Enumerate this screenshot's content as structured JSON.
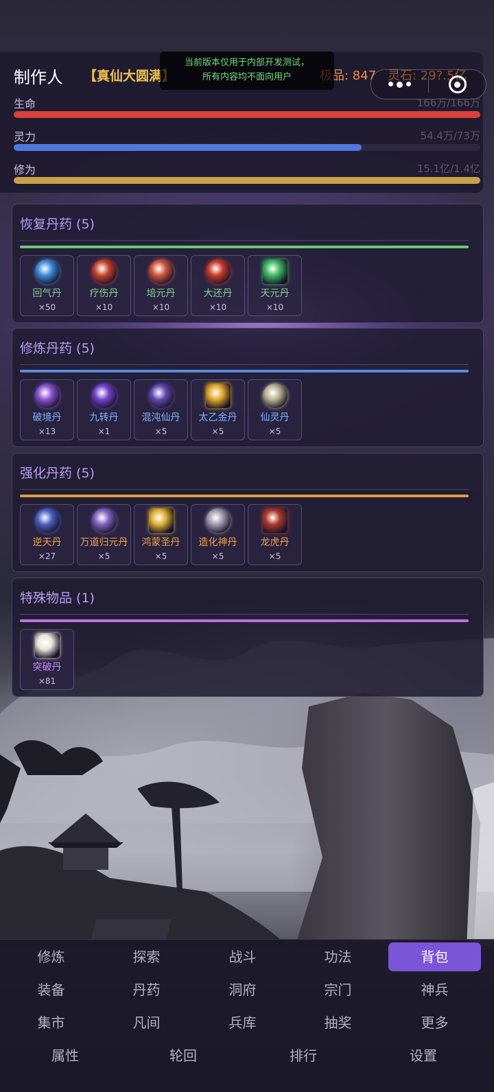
{
  "player": {
    "name": "制作人",
    "realm": "【真仙大圆满】",
    "jipin": "极品: 847",
    "lingshi": "灵石: 29?.5亿"
  },
  "dev_notice": {
    "line1": "当前版本仅用于内部开发测试，",
    "line2": "所有内容均不面向用户"
  },
  "capsule": {
    "more_icon": "more-dots-icon",
    "close_icon": "target-close-icon"
  },
  "bars": [
    {
      "label": "生命",
      "value": "166万/166万",
      "fraction": 1.0,
      "color": "#d8403c"
    },
    {
      "label": "灵力",
      "value": "54.4万/73万",
      "fraction": 0.745,
      "color": "#4f78dd"
    },
    {
      "label": "修为",
      "value": "15.1亿/1.4亿",
      "fraction": 1.0,
      "color": "#c9a04a"
    }
  ],
  "sections": [
    {
      "title": "恢复丹药 (5)",
      "rule_color": "#6cc86e",
      "name_class": "green",
      "items": [
        {
          "name": "回气丹",
          "count": "×50",
          "icon": "swirl-pill-icon",
          "color": "#3a8ad8"
        },
        {
          "name": "疗伤丹",
          "count": "×10",
          "icon": "red-pill-icon",
          "color": "#c8402c"
        },
        {
          "name": "培元丹",
          "count": "×10",
          "icon": "red-pill-icon",
          "color": "#d0523c"
        },
        {
          "name": "大还丹",
          "count": "×10",
          "icon": "red-pill-icon",
          "color": "#c83828"
        },
        {
          "name": "天元丹",
          "count": "×10",
          "icon": "green-pill-icon",
          "color": "#3cb860"
        }
      ]
    },
    {
      "title": "修炼丹药 (5)",
      "rule_color": "#5a8ae0",
      "name_class": "blue",
      "items": [
        {
          "name": "破境丹",
          "count": "×13",
          "icon": "galaxy-pill-icon",
          "color": "#8a50d0"
        },
        {
          "name": "九转丹",
          "count": "×1",
          "icon": "vortex-pill-icon",
          "color": "#7040c8"
        },
        {
          "name": "混沌仙丹",
          "count": "×5",
          "icon": "chaos-pill-icon",
          "color": "#6048b0"
        },
        {
          "name": "太乙金丹",
          "count": "×5",
          "icon": "gold-pill-icon",
          "color": "#e0a828"
        },
        {
          "name": "仙灵丹",
          "count": "×5",
          "icon": "pearl-pill-icon",
          "color": "#b8b090"
        }
      ]
    },
    {
      "title": "强化丹药 (5)",
      "rule_color": "#e09a42",
      "name_class": "orange",
      "items": [
        {
          "name": "逆天丹",
          "count": "×27",
          "icon": "nebula-pill-icon",
          "color": "#4a60c0"
        },
        {
          "name": "万道归元丹",
          "count": "×5",
          "icon": "galaxy-pill-icon",
          "color": "#8060c0"
        },
        {
          "name": "鸿蒙圣丹",
          "count": "×5",
          "icon": "sun-pill-icon",
          "color": "#e0b030"
        },
        {
          "name": "造化神丹",
          "count": "×5",
          "icon": "ring-pill-icon",
          "color": "#a09ab0"
        },
        {
          "name": "龙虎丹",
          "count": "×5",
          "icon": "dragon-pill-icon",
          "color": "#b03828"
        }
      ]
    },
    {
      "title": "特殊物品 (1)",
      "rule_color": "#c070e0",
      "name_class": "purple",
      "items": [
        {
          "name": "突破丹",
          "count": "×81",
          "icon": "white-pill-icon",
          "color": "#e8e4d8"
        }
      ]
    }
  ],
  "nav": {
    "rows": [
      [
        "修炼",
        "探索",
        "战斗",
        "功法",
        "背包"
      ],
      [
        "装备",
        "丹药",
        "洞府",
        "宗门",
        "神兵"
      ],
      [
        "集市",
        "凡间",
        "兵库",
        "抽奖",
        "更多"
      ],
      [
        "属性",
        "轮回",
        "排行",
        "设置"
      ]
    ],
    "active": "背包"
  }
}
